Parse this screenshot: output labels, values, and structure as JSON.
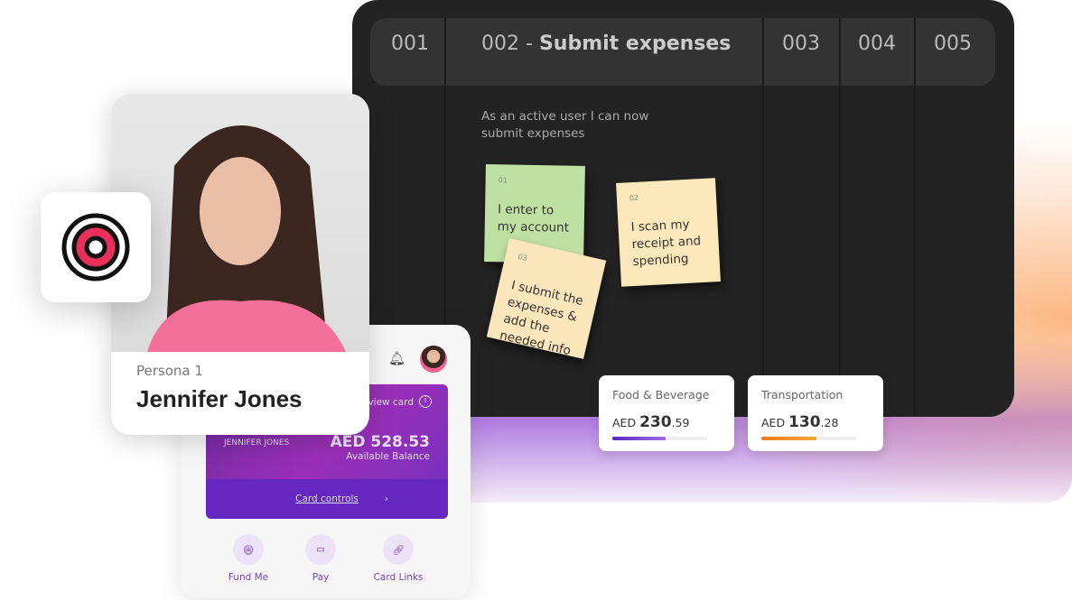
{
  "board": {
    "columns": [
      "001",
      "002",
      "003",
      "004",
      "005"
    ],
    "active_column_title": "Submit expenses",
    "story": "As an active user I can now submit expenses",
    "notes": [
      {
        "num": "01",
        "text": "I enter to my account",
        "color": "#bfe0a3"
      },
      {
        "num": "02",
        "text": "I scan my receipt and spending",
        "color": "#fde8bc"
      },
      {
        "num": "03",
        "text": "I submit the expenses & add the needed info",
        "color": "#fce6bb"
      }
    ]
  },
  "stats": [
    {
      "label": "Food & Beverage",
      "currency": "AED",
      "whole": "230",
      "cents": ".59",
      "progress": 0.56,
      "color": "#6a2fd0"
    },
    {
      "label": "Transportation",
      "currency": "AED",
      "whole": "130",
      "cents": ".28",
      "progress": 0.58,
      "color": "#f08a2a"
    }
  ],
  "persona": {
    "label": "Persona 1",
    "name": "Jennifer Jones"
  },
  "phone": {
    "view_card": "view card",
    "cardholder": "JENNIFER JONES",
    "balance": "AED 528.53",
    "balance_label": "Available Balance",
    "card_controls": "Card controls",
    "actions": [
      {
        "label": "Fund Me",
        "icon": "coins-icon"
      },
      {
        "label": "Pay",
        "icon": "pay-card-icon"
      },
      {
        "label": "Card Links",
        "icon": "link-icon"
      }
    ]
  }
}
